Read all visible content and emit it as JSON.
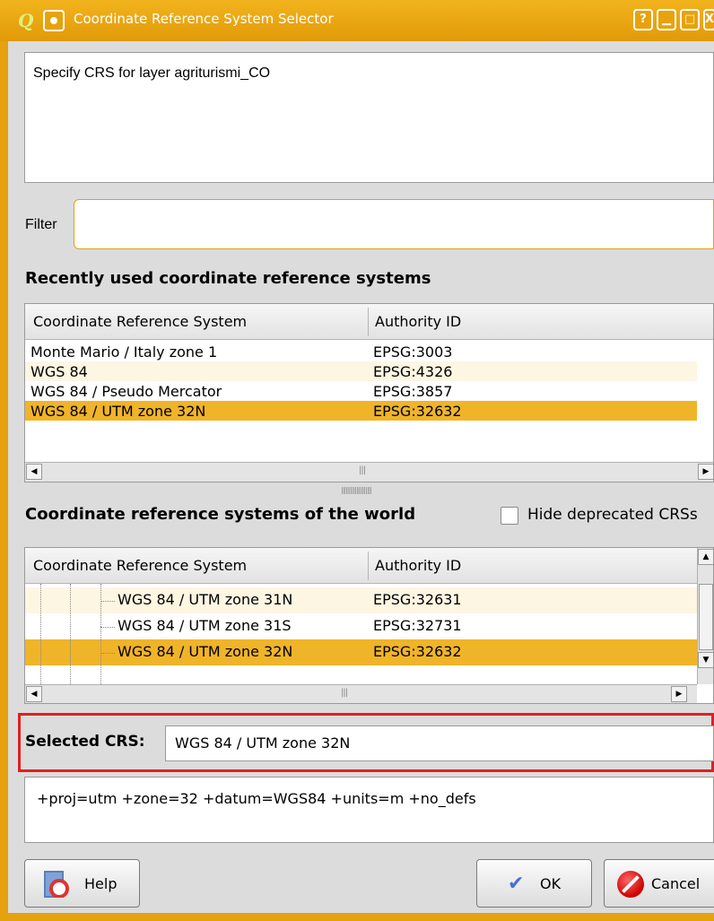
{
  "window": {
    "title": "Coordinate Reference System Selector",
    "help_glyph": "?",
    "minimize_glyph": "▁",
    "maximize_glyph": "□",
    "close_glyph": "X"
  },
  "description": "Specify CRS for layer agriturismi_CO",
  "filter": {
    "label": "Filter",
    "value": ""
  },
  "recent": {
    "title": "Recently used coordinate reference systems",
    "col_crs": "Coordinate Reference System",
    "col_auth": "Authority ID",
    "rows": [
      {
        "crs": "Monte Mario / Italy zone 1",
        "auth": "EPSG:3003"
      },
      {
        "crs": "WGS 84",
        "auth": "EPSG:4326"
      },
      {
        "crs": "WGS 84 / Pseudo Mercator",
        "auth": "EPSG:3857"
      },
      {
        "crs": "WGS 84 / UTM zone 32N",
        "auth": "EPSG:32632",
        "selected": true
      }
    ]
  },
  "world": {
    "title": "Coordinate reference systems of the world",
    "hide_deprecated_label": "Hide deprecated CRSs",
    "hide_deprecated_checked": false,
    "col_crs": "Coordinate Reference System",
    "col_auth": "Authority ID",
    "rows": [
      {
        "crs": "WGS 84 / UTM zone 31N",
        "auth": "EPSG:32631"
      },
      {
        "crs": "WGS 84 / UTM zone 31S",
        "auth": "EPSG:32731"
      },
      {
        "crs": "WGS 84 / UTM zone 32N",
        "auth": "EPSG:32632",
        "selected": true
      }
    ]
  },
  "selected_crs": {
    "label": "Selected CRS:",
    "value": "WGS 84 / UTM zone 32N"
  },
  "proj_string": "+proj=utm +zone=32 +datum=WGS84 +units=m +no_defs",
  "buttons": {
    "help": "Help",
    "ok": "OK",
    "cancel": "Cancel"
  },
  "colors": {
    "accent": "#e5a10e",
    "selection": "#f0b429",
    "alt_row": "#fdf6e3",
    "highlight_border": "#e02020"
  },
  "icons": [
    "qgis-logo-icon",
    "window-menu-icon",
    "help-icon",
    "ok-check-icon",
    "cancel-icon"
  ]
}
